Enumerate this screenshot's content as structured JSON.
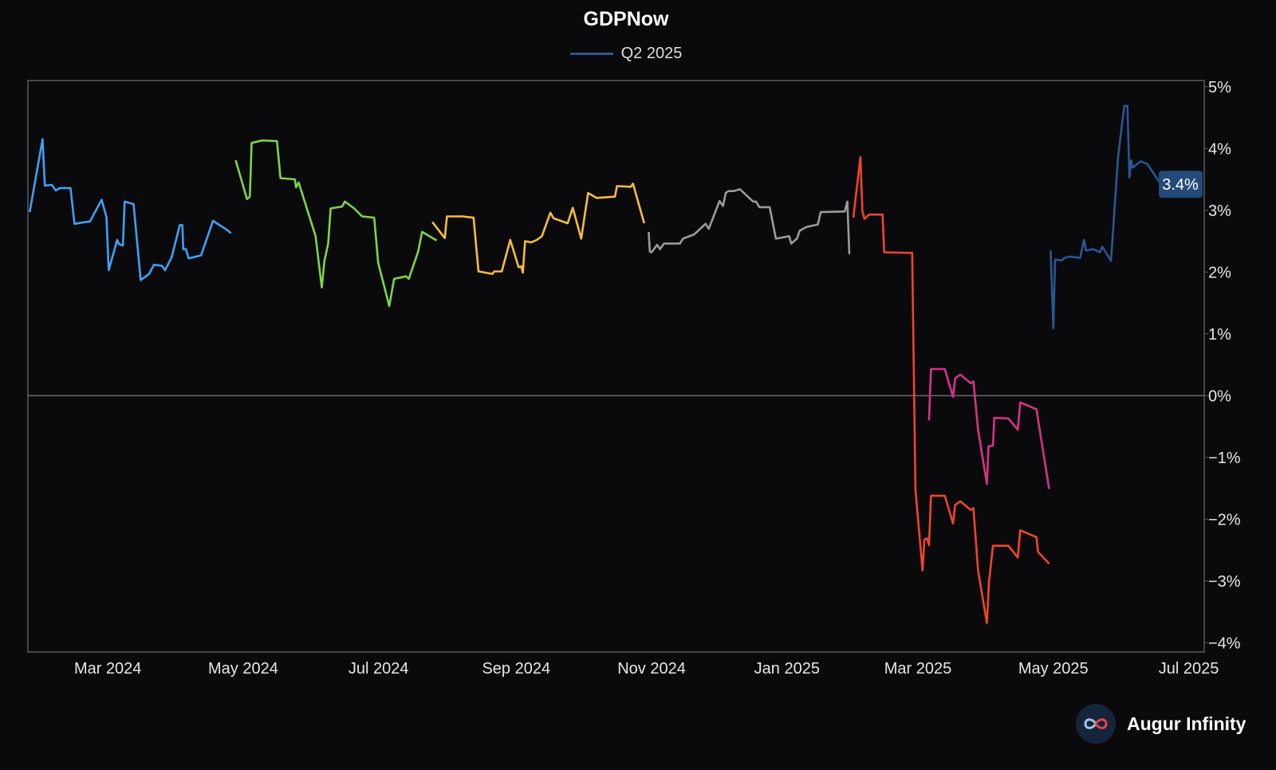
{
  "chart_data": {
    "type": "line",
    "title": "GDPNow",
    "legend": [
      {
        "label": "Q2 2025",
        "color": "#2b5693"
      }
    ],
    "legend_position": "top-center",
    "x_unit": "days since 2024-01-01",
    "xlim": [
      24,
      554
    ],
    "ylim": [
      -4.15,
      5.1
    ],
    "ylabel": "",
    "xlabel": "",
    "y_ticks": [
      {
        "value": 5,
        "label": "5%"
      },
      {
        "value": 4,
        "label": "4%"
      },
      {
        "value": 3,
        "label": "3%"
      },
      {
        "value": 2,
        "label": "2%"
      },
      {
        "value": 1,
        "label": "1%"
      },
      {
        "value": 0,
        "label": "0%"
      },
      {
        "value": -1,
        "label": "−1%"
      },
      {
        "value": -2,
        "label": "−2%"
      },
      {
        "value": -3,
        "label": "−3%"
      },
      {
        "value": -4,
        "label": "−4%"
      }
    ],
    "x_ticks": [
      {
        "value": 60,
        "label": "Mar 2024"
      },
      {
        "value": 121,
        "label": "May 2024"
      },
      {
        "value": 182,
        "label": "Jul 2024"
      },
      {
        "value": 244,
        "label": "Sep 2024"
      },
      {
        "value": 305,
        "label": "Nov 2024"
      },
      {
        "value": 366,
        "label": "Jan 2025"
      },
      {
        "value": 425,
        "label": "Mar 2025"
      },
      {
        "value": 486,
        "label": "May 2025"
      },
      {
        "value": 547,
        "label": "Jul 2025"
      }
    ],
    "zero_line": true,
    "last_value_label": "3.4%",
    "series": [
      {
        "color": "#3fa0f5",
        "points": [
          [
            24.8,
            2.97
          ],
          [
            30.6,
            4.15
          ],
          [
            31.6,
            3.4
          ],
          [
            34.8,
            3.41
          ],
          [
            36.6,
            3.32
          ],
          [
            38.4,
            3.36
          ],
          [
            43.2,
            3.36
          ],
          [
            45.0,
            2.78
          ],
          [
            52.0,
            2.82
          ],
          [
            57.2,
            3.17
          ],
          [
            59.4,
            2.89
          ],
          [
            60.4,
            2.03
          ],
          [
            64.2,
            2.52
          ],
          [
            65.1,
            2.45
          ],
          [
            66.8,
            2.43
          ],
          [
            67.6,
            3.14
          ],
          [
            71.6,
            3.1
          ],
          [
            74.8,
            1.87
          ],
          [
            78.6,
            1.97
          ],
          [
            80.8,
            2.12
          ],
          [
            84.4,
            2.1
          ],
          [
            85.8,
            2.03
          ],
          [
            88.8,
            2.24
          ],
          [
            92.4,
            2.76
          ],
          [
            93.6,
            2.76
          ],
          [
            94.0,
            2.37
          ],
          [
            95.2,
            2.37
          ],
          [
            96.4,
            2.22
          ],
          [
            102.0,
            2.27
          ],
          [
            107.4,
            2.83
          ],
          [
            113.4,
            2.69
          ],
          [
            115.5,
            2.63
          ]
        ]
      },
      {
        "color": "#7ed34a",
        "points": [
          [
            117.6,
            3.81
          ],
          [
            122.7,
            3.18
          ],
          [
            124.0,
            3.22
          ],
          [
            124.8,
            4.09
          ],
          [
            129.6,
            4.13
          ],
          [
            136.2,
            4.12
          ],
          [
            137.8,
            3.52
          ],
          [
            144.3,
            3.5
          ],
          [
            144.8,
            3.37
          ],
          [
            146.0,
            3.45
          ],
          [
            153.6,
            2.58
          ],
          [
            156.4,
            1.75
          ],
          [
            157.6,
            2.18
          ],
          [
            159.3,
            2.46
          ],
          [
            160.4,
            3.03
          ],
          [
            165.6,
            3.06
          ],
          [
            166.8,
            3.14
          ],
          [
            171.0,
            3.03
          ],
          [
            174.6,
            2.9
          ],
          [
            180.0,
            2.88
          ],
          [
            181.8,
            2.15
          ],
          [
            186.8,
            1.45
          ],
          [
            189.0,
            1.89
          ],
          [
            194.4,
            1.93
          ],
          [
            195.6,
            1.89
          ],
          [
            199.8,
            2.33
          ],
          [
            201.6,
            2.65
          ],
          [
            208.2,
            2.51
          ]
        ]
      },
      {
        "color": "#f6bd3a",
        "points": [
          [
            206.2,
            2.81
          ],
          [
            211.8,
            2.55
          ],
          [
            212.8,
            2.9
          ],
          [
            219.8,
            2.9
          ],
          [
            224.8,
            2.88
          ],
          [
            227.0,
            2.01
          ],
          [
            233.3,
            1.97
          ],
          [
            234.1,
            2.01
          ],
          [
            237.5,
            2.01
          ],
          [
            241.3,
            2.52
          ],
          [
            245.1,
            2.08
          ],
          [
            246.3,
            2.09
          ],
          [
            247.0,
            1.99
          ],
          [
            248.0,
            2.5
          ],
          [
            250.8,
            2.48
          ],
          [
            253.3,
            2.52
          ],
          [
            255.6,
            2.58
          ],
          [
            259.4,
            2.96
          ],
          [
            260.9,
            2.87
          ],
          [
            267.2,
            2.79
          ],
          [
            269.5,
            3.04
          ],
          [
            273.3,
            2.54
          ],
          [
            276.4,
            3.28
          ],
          [
            280.2,
            3.2
          ],
          [
            288.5,
            3.22
          ],
          [
            289.4,
            3.39
          ],
          [
            295.7,
            3.38
          ],
          [
            296.6,
            3.43
          ],
          [
            301.7,
            2.79
          ]
        ]
      },
      {
        "color": "#9a9a9a",
        "points": [
          [
            303.7,
            2.65
          ],
          [
            304.2,
            2.33
          ],
          [
            305.0,
            2.32
          ],
          [
            307.5,
            2.44
          ],
          [
            308.8,
            2.37
          ],
          [
            310.6,
            2.46
          ],
          [
            317.7,
            2.46
          ],
          [
            319.2,
            2.54
          ],
          [
            324.2,
            2.61
          ],
          [
            329.3,
            2.78
          ],
          [
            330.8,
            2.7
          ],
          [
            335.6,
            3.15
          ],
          [
            337.2,
            3.07
          ],
          [
            338.4,
            3.28
          ],
          [
            339.7,
            3.31
          ],
          [
            342.0,
            3.31
          ],
          [
            344.8,
            3.34
          ],
          [
            350.8,
            3.14
          ],
          [
            352.1,
            3.14
          ],
          [
            353.6,
            3.05
          ],
          [
            358.2,
            3.05
          ],
          [
            361.0,
            2.54
          ],
          [
            367.0,
            2.58
          ],
          [
            367.9,
            2.46
          ],
          [
            370.5,
            2.54
          ],
          [
            371.7,
            2.67
          ],
          [
            374.9,
            2.73
          ],
          [
            379.9,
            2.77
          ],
          [
            381.2,
            2.97
          ],
          [
            392.0,
            2.98
          ],
          [
            393.2,
            3.14
          ],
          [
            394.1,
            2.29
          ]
        ]
      },
      {
        "color": "#f0442a",
        "points": [
          [
            395.9,
            2.88
          ],
          [
            399.1,
            3.86
          ],
          [
            400.0,
            2.98
          ],
          [
            400.9,
            2.86
          ],
          [
            403.0,
            2.93
          ],
          [
            409.1,
            2.93
          ],
          [
            409.8,
            2.32
          ],
          [
            422.4,
            2.31
          ],
          [
            423.9,
            -1.52
          ],
          [
            427.1,
            -2.83
          ],
          [
            427.9,
            -2.33
          ],
          [
            429.1,
            -2.31
          ],
          [
            430.0,
            -2.42
          ],
          [
            430.9,
            -1.62
          ],
          [
            437.1,
            -1.62
          ],
          [
            440.8,
            -2.07
          ],
          [
            441.8,
            -1.77
          ],
          [
            444.1,
            -1.71
          ],
          [
            448.8,
            -1.85
          ],
          [
            450.0,
            -1.82
          ],
          [
            452.1,
            -2.83
          ],
          [
            456.1,
            -3.68
          ],
          [
            457.0,
            -3.03
          ],
          [
            458.8,
            -2.43
          ],
          [
            465.8,
            -2.43
          ],
          [
            470.0,
            -2.62
          ],
          [
            471.1,
            -2.18
          ],
          [
            478.4,
            -2.29
          ],
          [
            479.1,
            -2.53
          ],
          [
            484.1,
            -2.72
          ]
        ]
      },
      {
        "color": "#d63384",
        "points": [
          [
            430.0,
            -0.4
          ],
          [
            430.9,
            0.43
          ],
          [
            437.1,
            0.43
          ],
          [
            440.8,
            -0.02
          ],
          [
            441.8,
            0.28
          ],
          [
            444.1,
            0.34
          ],
          [
            448.8,
            0.2
          ],
          [
            450.0,
            0.23
          ],
          [
            452.1,
            -0.55
          ],
          [
            456.1,
            -1.43
          ],
          [
            456.8,
            -0.82
          ],
          [
            458.8,
            -0.81
          ],
          [
            459.4,
            -0.36
          ],
          [
            465.8,
            -0.37
          ],
          [
            470.0,
            -0.55
          ],
          [
            471.1,
            -0.11
          ],
          [
            478.4,
            -0.22
          ],
          [
            484.1,
            -1.51
          ]
        ]
      },
      {
        "color": "#2b5693",
        "points": [
          [
            484.8,
            2.35
          ],
          [
            486.0,
            1.09
          ],
          [
            486.8,
            2.2
          ],
          [
            490.0,
            2.19
          ],
          [
            491.0,
            2.23
          ],
          [
            493.3,
            2.25
          ],
          [
            498.1,
            2.23
          ],
          [
            499.8,
            2.52
          ],
          [
            500.7,
            2.35
          ],
          [
            504.0,
            2.37
          ],
          [
            506.9,
            2.32
          ],
          [
            508.1,
            2.41
          ],
          [
            512.0,
            2.18
          ],
          [
            515.2,
            3.87
          ],
          [
            518.0,
            4.69
          ],
          [
            519.4,
            4.69
          ],
          [
            520.3,
            3.53
          ],
          [
            521.1,
            3.81
          ],
          [
            521.7,
            3.69
          ],
          [
            525.3,
            3.79
          ],
          [
            528.3,
            3.75
          ],
          [
            534.5,
            3.42
          ]
        ]
      }
    ]
  },
  "brand": {
    "name": "Augur Infinity"
  }
}
